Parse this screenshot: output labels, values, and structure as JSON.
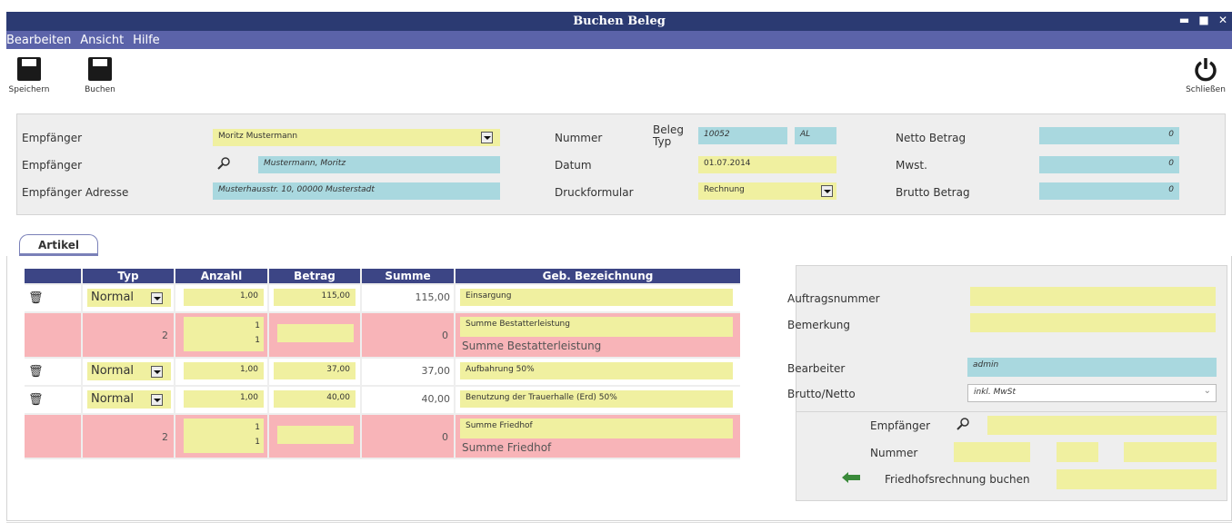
{
  "window": {
    "title": "Buchen Beleg",
    "controls": "▬ ■ ✕"
  },
  "menu": [
    "Bearbeiten",
    "Ansicht",
    "Hilfe"
  ],
  "toolbar": {
    "save_label": "Speichern",
    "book_label": "Buchen",
    "close_label": "Schließen"
  },
  "header": {
    "empfaenger_label": "Empfänger",
    "empfaenger_value": "Moritz Mustermann",
    "empfaenger2_label": "Empfänger",
    "empfaenger2_value": "Mustermann, Moritz",
    "adresse_label": "Empfänger Adresse",
    "adresse_value": "Musterhausstr. 10, 00000 Musterstadt",
    "nummer_label": "Nummer",
    "belegtyp_label_1": "Beleg",
    "belegtyp_label_2": "Typ",
    "nummer_value": "10052",
    "belegtyp_value": "AL",
    "datum_label": "Datum",
    "datum_value": "01.07.2014",
    "druck_label": "Druckformular",
    "druck_value": "Rechnung",
    "netto_label": "Netto Betrag",
    "netto_value": "0",
    "mwst_label": "Mwst.",
    "mwst_value": "0",
    "brutto_label": "Brutto Betrag",
    "brutto_value": "0"
  },
  "tab": {
    "label": "Artikel"
  },
  "grid": {
    "columns": [
      "",
      "Typ",
      "Anzahl",
      "Betrag",
      "Summe",
      "Geb. Bezeichnung"
    ],
    "rows": [
      {
        "type": "Normal",
        "anzahl": "1,00",
        "betrag": "115,00",
        "summe": "115,00",
        "bez": "Einsargung"
      },
      {
        "group": "2",
        "anzahl_top": "1",
        "anzahl_bottom": "1",
        "summe": "0",
        "bez_top": "Summe Bestatterleistung",
        "bez_bottom": "Summe Bestatterleistung"
      },
      {
        "type": "Normal",
        "anzahl": "1,00",
        "betrag": "37,00",
        "summe": "37,00",
        "bez": "Aufbahrung 50%"
      },
      {
        "type": "Normal",
        "anzahl": "1,00",
        "betrag": "40,00",
        "summe": "40,00",
        "bez": "Benutzung der Trauerhalle (Erd) 50%"
      },
      {
        "group": "2",
        "anzahl_top": "1",
        "anzahl_bottom": "1",
        "summe": "0",
        "bez_top": "Summe Friedhof",
        "bez_bottom": "Summe Friedhof"
      }
    ]
  },
  "right": {
    "auftrag_label": "Auftragsnummer",
    "bemerkung_label": "Bemerkung",
    "bearbeiter_label": "Bearbeiter",
    "bearbeiter_value": "admin",
    "bruttonetto_label": "Brutto/Netto",
    "bruttonetto_value": "inkl. MwSt",
    "empf_label": "Empfänger",
    "nummer_label": "Nummer",
    "friedhof_label": "Friedhofsrechnung buchen"
  }
}
